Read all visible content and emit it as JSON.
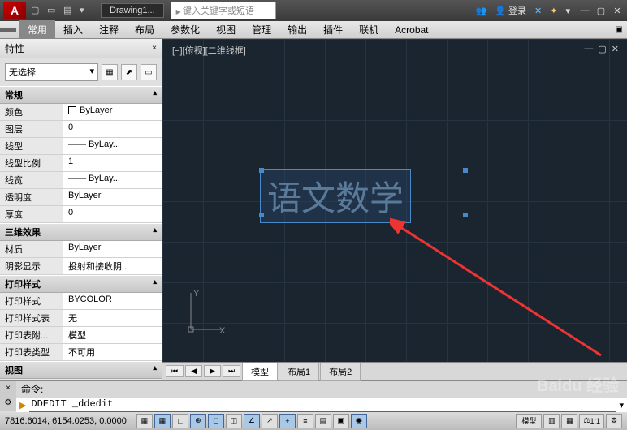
{
  "title": {
    "logo": "A",
    "docname": "Drawing1...",
    "search_placeholder": "键入关键字或短语",
    "login": "登录"
  },
  "ribbon": {
    "file": "",
    "tabs": [
      "常用",
      "插入",
      "注释",
      "布局",
      "参数化",
      "视图",
      "管理",
      "输出",
      "插件",
      "联机",
      "Acrobat"
    ],
    "active": 0
  },
  "props": {
    "title": "特性",
    "selection": "无选择",
    "groups": [
      {
        "name": "常规",
        "rows": [
          {
            "k": "颜色",
            "v": "ByLayer",
            "sq": true
          },
          {
            "k": "图层",
            "v": "0"
          },
          {
            "k": "线型",
            "v": "—— ByLay..."
          },
          {
            "k": "线型比例",
            "v": "1"
          },
          {
            "k": "线宽",
            "v": "—— ByLay..."
          },
          {
            "k": "透明度",
            "v": "ByLayer"
          },
          {
            "k": "厚度",
            "v": "0"
          }
        ]
      },
      {
        "name": "三维效果",
        "rows": [
          {
            "k": "材质",
            "v": "ByLayer"
          },
          {
            "k": "阴影显示",
            "v": "投射和接收阴..."
          }
        ]
      },
      {
        "name": "打印样式",
        "rows": [
          {
            "k": "打印样式",
            "v": "BYCOLOR"
          },
          {
            "k": "打印样式表",
            "v": "无"
          },
          {
            "k": "打印表附...",
            "v": "模型"
          },
          {
            "k": "打印表类型",
            "v": "不可用"
          }
        ]
      },
      {
        "name": "视图",
        "rows": []
      }
    ]
  },
  "viewport": {
    "label": "[−][俯视][二维线框]",
    "text_object": "语文数学",
    "ucs_x": "X",
    "ucs_y": "Y"
  },
  "modeltabs": {
    "model": "模型",
    "layout1": "布局1",
    "layout2": "布局2"
  },
  "command": {
    "prompt": "命令:",
    "input": "DDEDIT _ddedit"
  },
  "status": {
    "coords": "7816.6014, 6154.0253, 0.0000",
    "model": "模型",
    "scale": "1:1"
  },
  "watermark": "Baidu 经验"
}
